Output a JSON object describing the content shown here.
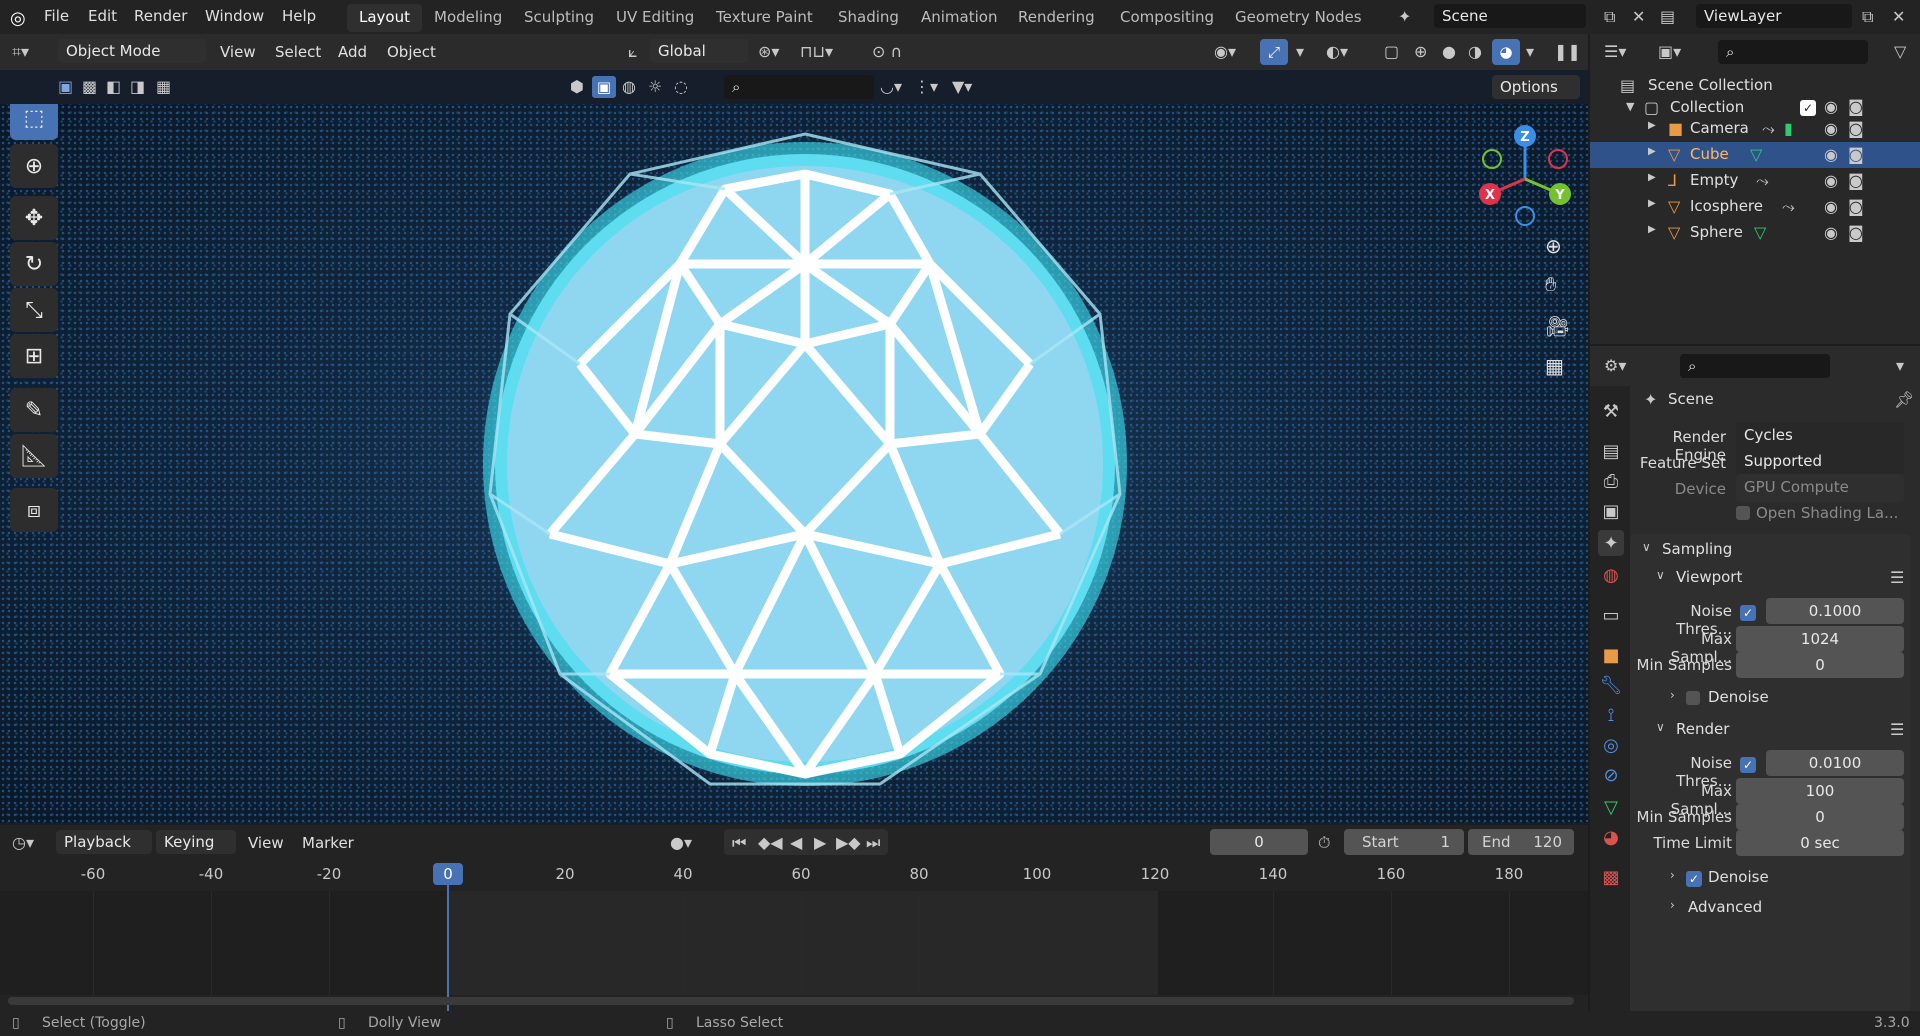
{
  "menus": [
    "File",
    "Edit",
    "Render",
    "Window",
    "Help"
  ],
  "workspaces": [
    "Layout",
    "Modeling",
    "Sculpting",
    "UV Editing",
    "Texture Paint",
    "Shading",
    "Animation",
    "Rendering",
    "Compositing",
    "Geometry Nodes"
  ],
  "scene_field": "Scene",
  "viewlayer_field": "ViewLayer",
  "viewport_header": {
    "mode": "Object Mode",
    "menus": [
      "View",
      "Select",
      "Add",
      "Object"
    ],
    "orientation": "Global",
    "options": "Options"
  },
  "outliner": {
    "title": "Scene Collection",
    "collection": "Collection",
    "items": [
      {
        "name": "Camera",
        "color": "#e89a45",
        "selected": false
      },
      {
        "name": "Cube",
        "color": "#e89a45",
        "selected": true
      },
      {
        "name": "Empty",
        "color": "#e89a45",
        "selected": false
      },
      {
        "name": "Icosphere",
        "color": "#e89a45",
        "selected": false
      },
      {
        "name": "Sphere",
        "color": "#e89a45",
        "selected": false
      }
    ]
  },
  "properties": {
    "context": "Scene",
    "render_engine_label": "Render Engine",
    "render_engine": "Cycles",
    "feature_set_label": "Feature Set",
    "feature_set": "Supported",
    "device_label": "Device",
    "device": "GPU Compute",
    "osl": "Open Shading La...",
    "sampling": "Sampling",
    "viewport": {
      "title": "Viewport",
      "noise_label": "Noise Thres...",
      "noise": "0.1000",
      "max_label": "Max Sampl...",
      "max": "1024",
      "min_label": "Min Samples",
      "min": "0",
      "denoise": "Denoise"
    },
    "render": {
      "title": "Render",
      "noise_label": "Noise Thres...",
      "noise": "0.0100",
      "max_label": "Max Sampl...",
      "max": "100",
      "min_label": "Min Samples",
      "min": "0",
      "time_label": "Time Limit",
      "time": "0 sec",
      "denoise": "Denoise"
    },
    "advanced": "Advanced"
  },
  "timeline": {
    "menus": [
      "Playback",
      "Keying",
      "View",
      "Marker"
    ],
    "current_frame": "0",
    "start_label": "Start",
    "start": "1",
    "end_label": "End",
    "end": "120",
    "ticks": [
      "-60",
      "-40",
      "-20",
      "0",
      "20",
      "40",
      "60",
      "80",
      "100",
      "120",
      "140",
      "160",
      "180"
    ]
  },
  "status": {
    "select": "Select (Toggle)",
    "dolly": "Dolly View",
    "lasso": "Lasso Select",
    "version": "3.3.0"
  }
}
